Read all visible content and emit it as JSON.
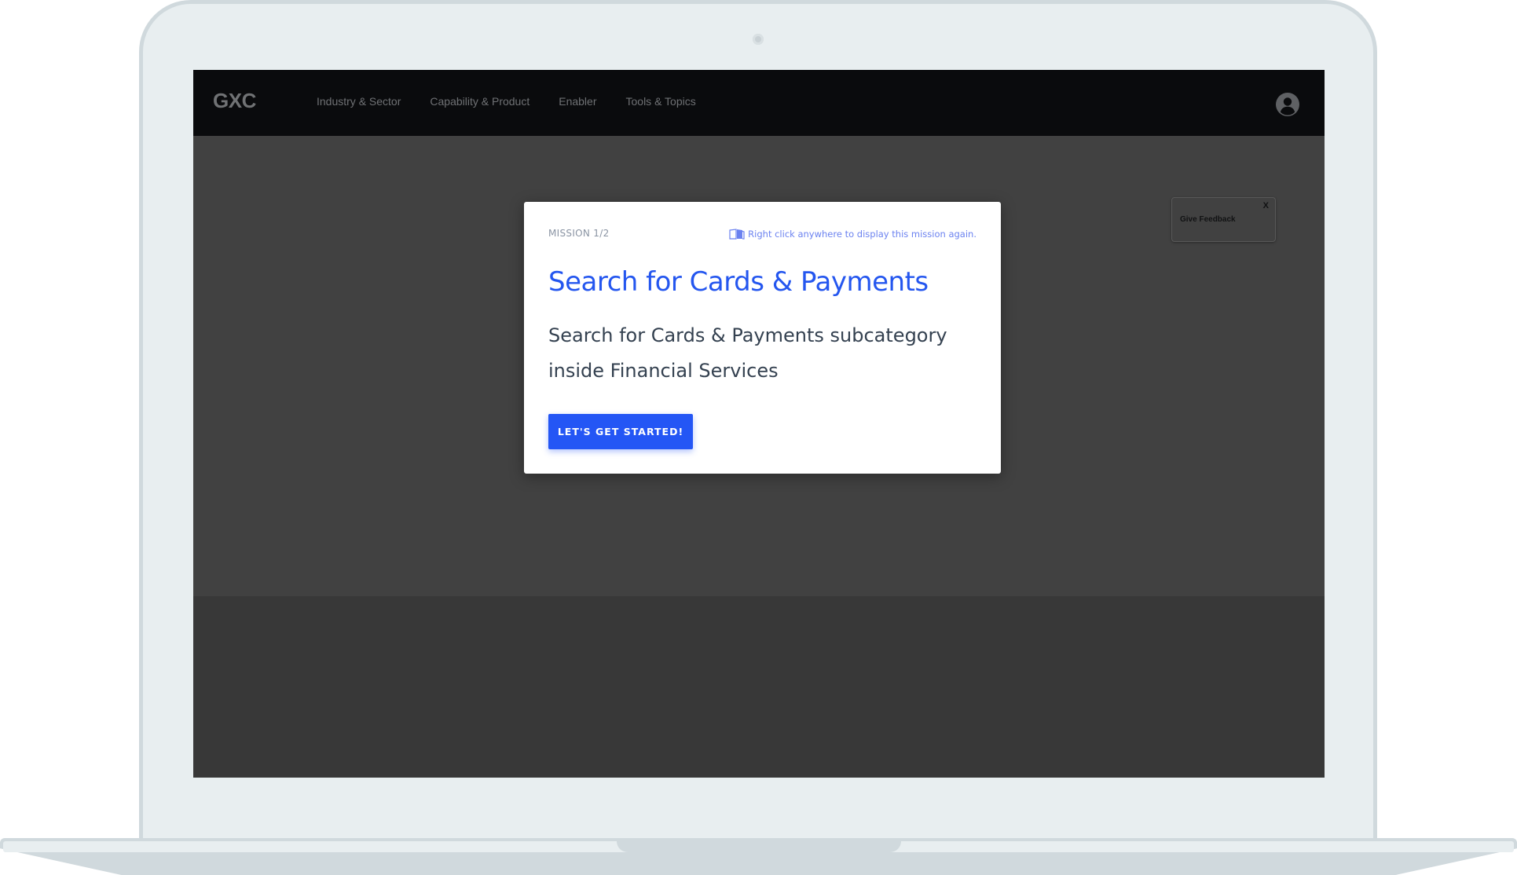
{
  "app": {
    "logo": "GXC"
  },
  "nav": {
    "items": [
      {
        "label": "Industry & Sector"
      },
      {
        "label": "Capability & Product"
      },
      {
        "label": "Enabler"
      },
      {
        "label": "Tools & Topics"
      }
    ],
    "avatar_icon": "user-circle-icon"
  },
  "feedback": {
    "label": "Give Feedback",
    "close_label": "X"
  },
  "mission": {
    "counter": "MISSION 1/2",
    "hint_icon": "book-icon",
    "hint": "Right click anywhere to display this mission again.",
    "title": "Search for Cards & Payments",
    "description": "Search for Cards & Payments subcategory inside Financial Services",
    "cta_label": "LET'S GET STARTED!"
  },
  "colors": {
    "accent": "#2456f5",
    "title": "#2456ef",
    "hint": "#6b82f0",
    "navbar": "#0a0b0d",
    "overlay": "#414141"
  }
}
